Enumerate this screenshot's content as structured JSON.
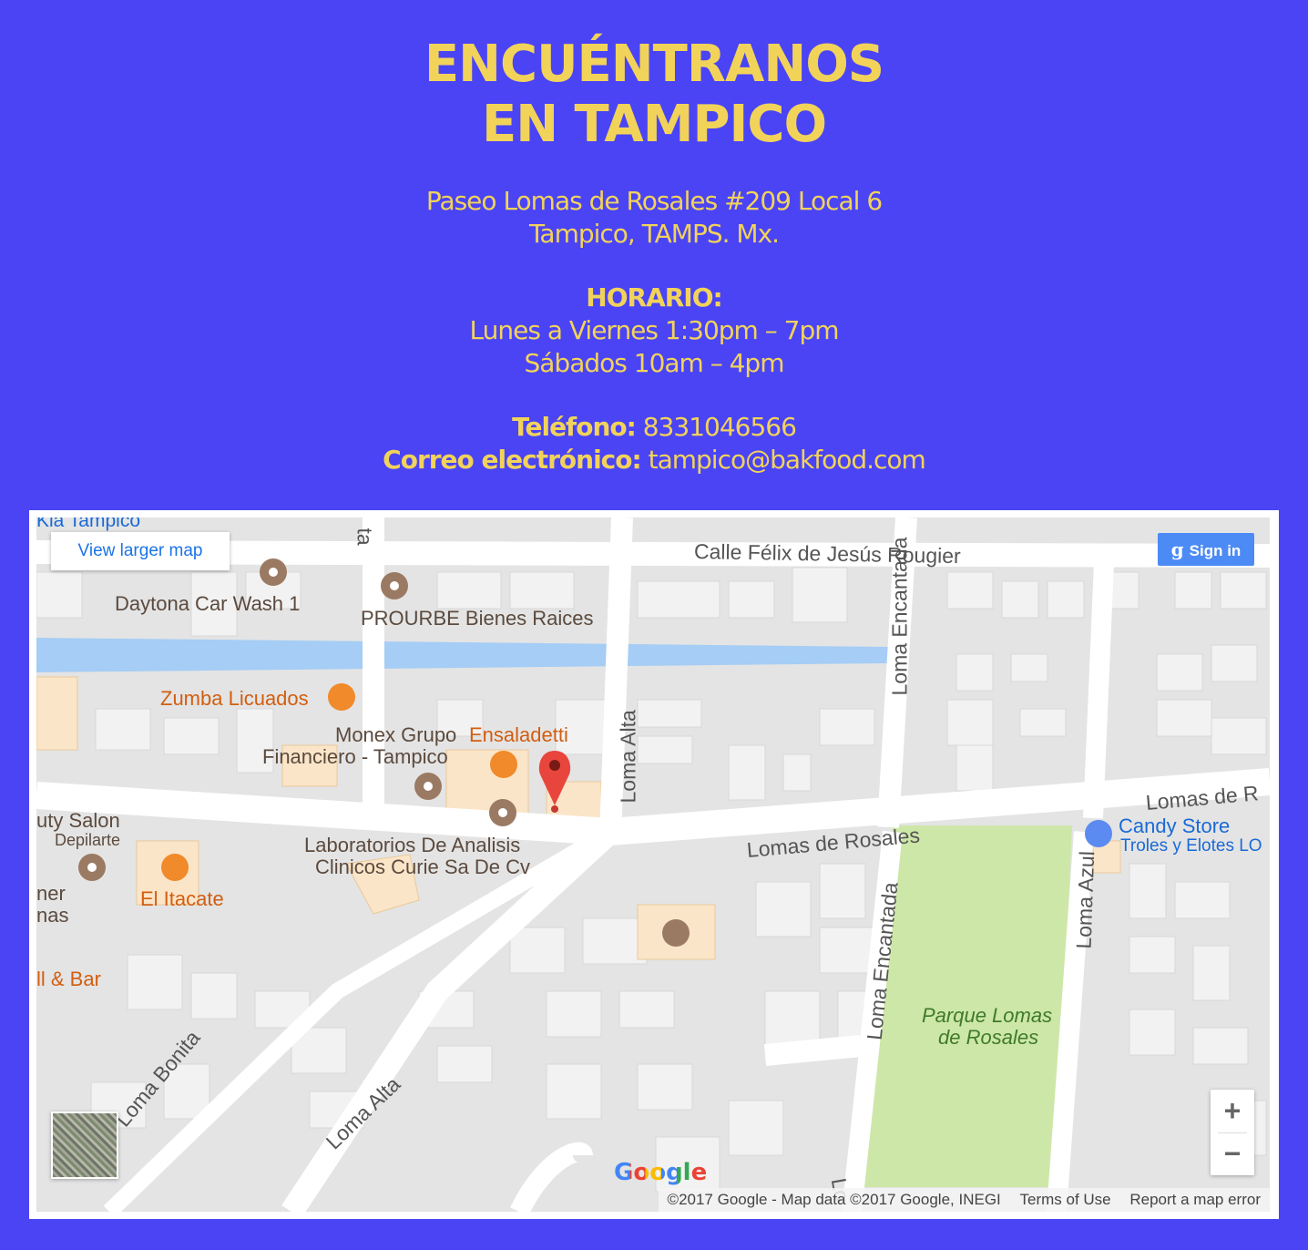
{
  "header": {
    "title_line1": "ENCUÉNTRANOS",
    "title_line2": "EN TAMPICO",
    "address_line1": "Paseo Lomas de Rosales #209 Local 6",
    "address_line2": "Tampico, TAMPS. Mx.",
    "hours_label": "HORARIO:",
    "hours_weekday": "Lunes a Viernes  1:30pm – 7pm",
    "hours_saturday": "Sábados  10am – 4pm",
    "phone_label": "Teléfono:",
    "phone_value": " 8331046566",
    "email_label": "Correo electrónico:",
    "email_value": " tampico@bakfood.com"
  },
  "map": {
    "view_larger": "View larger map",
    "sign_in": "Sign in",
    "zoom_in": "+",
    "zoom_out": "−",
    "google": "Google",
    "copyright": "©2017 Google - Map data ©2017 Google, INEGI",
    "terms": "Terms of Use",
    "report": "Report a map error",
    "places": {
      "kia": "Kia Tampico",
      "daytona": "Daytona Car Wash 1",
      "prourbe": "PROURBE Bienes Raices",
      "zumba": "Zumba Licuados",
      "monex1": "Monex Grupo",
      "monex2": "Financiero - Tampico",
      "ensaladetti": "Ensaladetti",
      "salon1": "uty Salon",
      "salon2": "Depilarte",
      "itacate": "El Itacate",
      "lab1": "Laboratorios De Analisis",
      "lab2": "Clinicos Curie Sa De Cv",
      "candy": "Candy Store",
      "troles": "Troles y Elotes LO",
      "park1": "Parque Lomas",
      "park2": "de Rosales",
      "ner": "ner",
      "nas": "nas",
      "bar": "ll & Bar"
    },
    "roads": {
      "felix": "Calle Félix de Jesús Rougier",
      "encantada_top": "Loma Encantada",
      "encantada_bottom": "Loma Encantada",
      "alta_top": "Loma Alta",
      "alta_bottom": "Loma Alta",
      "rosales": "Lomas de Rosales",
      "rosales_right": "Lomas de R",
      "azul": "Loma Azul",
      "bonita": "Loma Bonita",
      "ta": "ta",
      "lo": "Lo"
    }
  }
}
